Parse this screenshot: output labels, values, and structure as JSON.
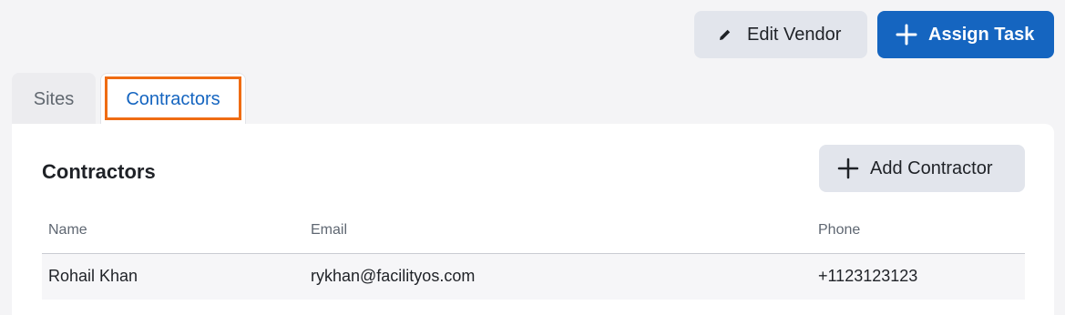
{
  "header": {
    "edit_vendor_label": "Edit Vendor",
    "assign_task_label": "Assign Task"
  },
  "tabs": [
    {
      "label": "Sites",
      "active": false
    },
    {
      "label": "Contractors",
      "active": true
    }
  ],
  "contractors": {
    "title": "Contractors",
    "add_button_label": "Add Contractor",
    "columns": {
      "name": "Name",
      "email": "Email",
      "phone": "Phone"
    },
    "rows": [
      {
        "name": "Rohail Khan",
        "email": "rykhan@facilityos.com",
        "phone": "+1123123123"
      }
    ]
  },
  "icons": {
    "edit": "pencil-icon",
    "assign": "plus-icon",
    "add": "plus-icon"
  },
  "colors": {
    "primary": "#1565c0",
    "secondary_button": "#e2e5ec",
    "focus_outline": "#ef6c13",
    "page_background": "#f4f4f6"
  }
}
